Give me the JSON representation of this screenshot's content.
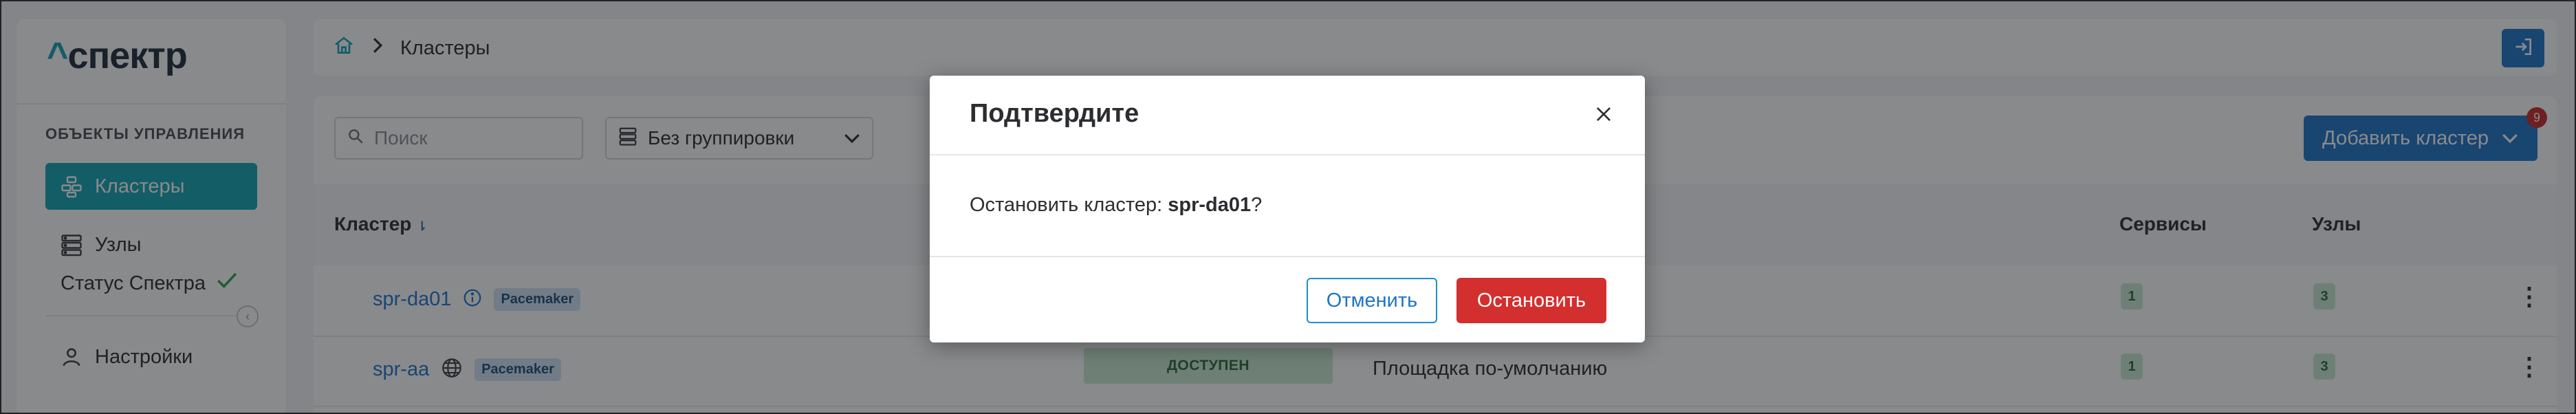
{
  "app": {
    "logo_text": "спектр",
    "logo_caret": "^"
  },
  "sidebar": {
    "section_title": "ОБЪЕКТЫ УПРАВЛЕНИЯ",
    "items": [
      {
        "label": "Кластеры",
        "icon": "stack-icon",
        "active": true
      },
      {
        "label": "Узлы",
        "icon": "server-icon",
        "active": false
      },
      {
        "label": "Статус Спектра",
        "icon": "check-icon",
        "active": false
      },
      {
        "label": "Настройки",
        "icon": "user-icon",
        "active": false
      }
    ]
  },
  "breadcrumb": {
    "current": "Кластеры"
  },
  "toolbar": {
    "search_placeholder": "Поиск",
    "grouping_value": "Без группировки",
    "add_button_label": "Добавить кластер",
    "notification_count": "9"
  },
  "table": {
    "columns": {
      "cluster": "Кластер",
      "services": "Сервисы",
      "nodes": "Узлы"
    },
    "rows": [
      {
        "name": "spr-da01",
        "tag": "Pacemaker",
        "status": "",
        "site": "",
        "services": "1",
        "nodes": "3"
      },
      {
        "name": "spr-aa",
        "tag": "Pacemaker",
        "status": "ДОСТУПЕН",
        "site": "Площадка по-умолчанию",
        "services": "1",
        "nodes": "3"
      }
    ]
  },
  "modal": {
    "title": "Подтвердите",
    "body_prefix": "Остановить кластер: ",
    "body_cluster": "spr-da01",
    "body_suffix": "?",
    "cancel_label": "Отменить",
    "confirm_label": "Остановить"
  },
  "colors": {
    "accent": "#13a4b5",
    "primary": "#1f74c9",
    "danger": "#d32f2f",
    "success_bg": "#c9ebd3"
  }
}
